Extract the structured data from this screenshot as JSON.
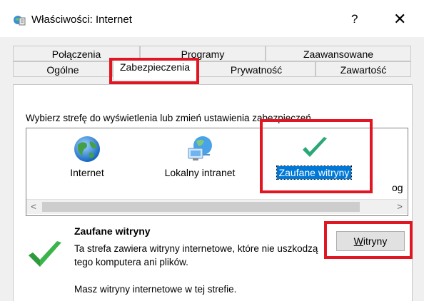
{
  "window": {
    "title": "Właściwości: Internet",
    "help": "?",
    "close": "✕"
  },
  "tabs": {
    "row1": [
      "Połączenia",
      "Programy",
      "Zaawansowane"
    ],
    "row2": [
      "Ogólne",
      "Zabezpieczenia",
      "Prywatność",
      "Zawartość"
    ],
    "selected": "Zabezpieczenia"
  },
  "instruction": "Wybierz strefę do wyświetlenia lub zmień ustawienia zabezpieczeń.",
  "zones": [
    {
      "label": "Internet",
      "icon": "globe-icon"
    },
    {
      "label": "Lokalny intranet",
      "icon": "intranet-icon"
    },
    {
      "label": "Zaufane witryny",
      "icon": "checkmark-icon",
      "selected": true
    },
    {
      "label": "og",
      "icon": ""
    }
  ],
  "scroll": {
    "left": "<",
    "right": ">"
  },
  "zone_info": {
    "title": "Zaufane witryny",
    "description": "Ta strefa zawiera witryny internetowe, które nie uszkodzą tego komputera ani plików.",
    "note": "Masz witryny internetowe w tej strefie.",
    "sites_button_mnemonic": "W",
    "sites_button_rest": "itryny"
  },
  "colors": {
    "highlight": "#e01722",
    "selection": "#0078d7",
    "check": "#2db84d"
  }
}
